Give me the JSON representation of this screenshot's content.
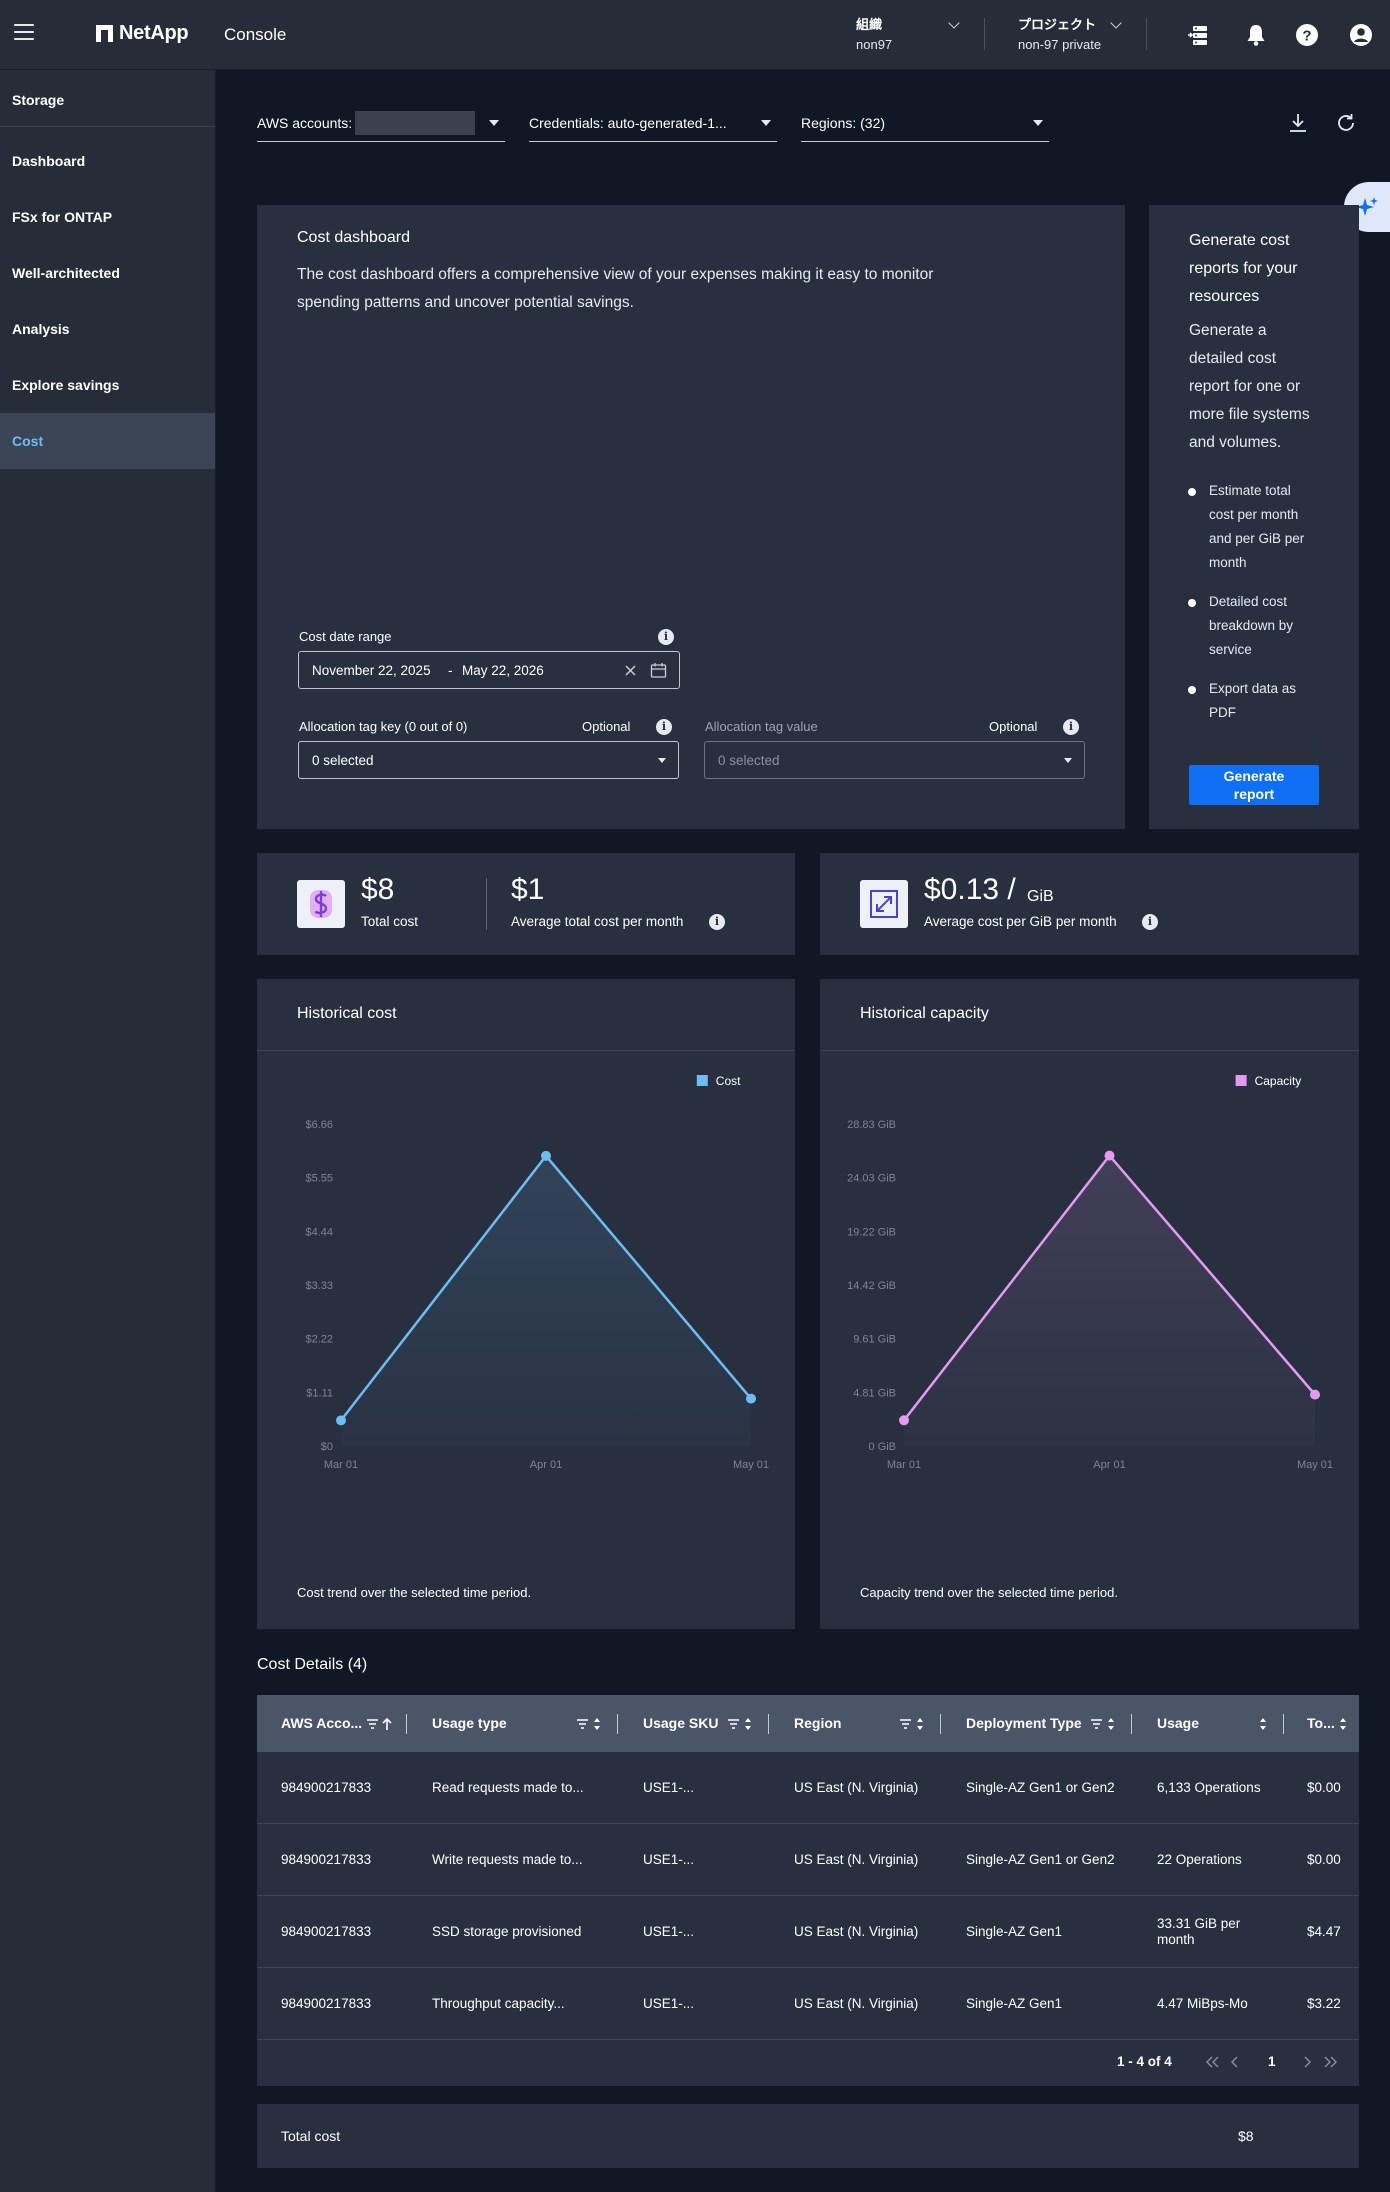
{
  "header": {
    "logo": "NetApp",
    "app": "Console",
    "org_label": "組織",
    "org_value": "non97",
    "project_label": "プロジェクト",
    "project_value": "non-97 private"
  },
  "sidebar": {
    "heading": "Storage",
    "items": [
      {
        "label": "Dashboard"
      },
      {
        "label": "FSx for ONTAP"
      },
      {
        "label": "Well-architected"
      },
      {
        "label": "Analysis"
      },
      {
        "label": "Explore savings"
      },
      {
        "label": "Cost"
      }
    ],
    "active_index": 5
  },
  "filters": {
    "aws_accounts": "AWS accounts:",
    "credentials": "Credentials: auto-generated-1...",
    "regions": "Regions: (32)"
  },
  "cost_dashboard": {
    "title": "Cost dashboard",
    "description_1": "The cost dashboard offers a comprehensive view of your expenses making it easy to monitor",
    "description_2": "spending patterns and uncover potential savings.",
    "date_range_label": "Cost date range",
    "date_start": "November 22, 2025",
    "date_sep": "-",
    "date_end": "May 22, 2026",
    "tag_key_label": "Allocation tag key (0 out of 0)",
    "tag_key_optional": "Optional",
    "tag_key_value": "0 selected",
    "tag_value_label": "Allocation tag value",
    "tag_value_optional": "Optional",
    "tag_value_value": "0 selected"
  },
  "generate_report": {
    "title_1": "Generate cost",
    "title_2": "reports for your",
    "title_3": "resources",
    "desc_1": "Generate a",
    "desc_2": "detailed cost",
    "desc_3": "report for one or",
    "desc_4": "more file systems",
    "desc_5": "and volumes.",
    "bullets": [
      {
        "l1": "Estimate total",
        "l2": "cost per month",
        "l3": "and per GiB per",
        "l4": "month"
      },
      {
        "l1": "Detailed cost",
        "l2": "breakdown by",
        "l3": "service"
      },
      {
        "l1": "Export data as",
        "l2": "PDF"
      }
    ],
    "button_1": "Generate",
    "button_2": "report"
  },
  "kpis": {
    "total_cost_value": "$8",
    "total_cost_label": "Total cost",
    "avg_month_value": "$1",
    "avg_month_label": "Average total cost per month",
    "avg_gib_value": "$0.13 /",
    "avg_gib_unit": "GiB",
    "avg_gib_label": "Average cost per GiB per month"
  },
  "chart_data": [
    {
      "type": "line",
      "title": "Historical cost",
      "x": [
        "Mar 01",
        "Apr 01",
        "May 01"
      ],
      "series": [
        {
          "name": "Cost",
          "values": [
            0.53,
            6.0,
            0.98
          ],
          "color": "#6dbcf2"
        }
      ],
      "yticks": [
        "$0",
        "$1.11",
        "$2.22",
        "$3.33",
        "$4.44",
        "$5.55",
        "$6.66"
      ],
      "ylim": [
        0,
        6.66
      ],
      "caption": "Cost trend over the selected time period.",
      "legend": "top-right"
    },
    {
      "type": "line",
      "title": "Historical capacity",
      "x": [
        "Mar 01",
        "Apr 01",
        "May 01"
      ],
      "series": [
        {
          "name": "Capacity",
          "values": [
            2.3,
            26.0,
            4.6
          ],
          "color": "#e39bf2"
        }
      ],
      "yticks": [
        "0 GiB",
        "4.81 GiB",
        "9.61 GiB",
        "14.42 GiB",
        "19.22 GiB",
        "24.03 GiB",
        "28.83 GiB"
      ],
      "ylim": [
        0,
        28.83
      ],
      "caption": "Capacity trend over the selected time period.",
      "legend": "top-right"
    }
  ],
  "cost_details": {
    "title": "Cost Details (4)",
    "columns": [
      "AWS Acco...",
      "Usage type",
      "Usage SKU",
      "Region",
      "Deployment Type",
      "Usage",
      "To..."
    ],
    "rows": [
      {
        "account": "984900217833",
        "usage_type": "Read requests made to...",
        "sku": "USE1-...",
        "region": "US East (N. Virginia)",
        "deployment": "Single-AZ Gen1 or Gen2",
        "usage_1": "6,133 Operations",
        "usage_2": "",
        "total": "$0.00"
      },
      {
        "account": "984900217833",
        "usage_type": "Write requests made to...",
        "sku": "USE1-...",
        "region": "US East (N. Virginia)",
        "deployment": "Single-AZ Gen1 or Gen2",
        "usage_1": "22 Operations",
        "usage_2": "",
        "total": "$0.00"
      },
      {
        "account": "984900217833",
        "usage_type": "SSD storage provisioned",
        "sku": "USE1-...",
        "region": "US East (N. Virginia)",
        "deployment": "Single-AZ Gen1",
        "usage_1": "33.31 GiB per",
        "usage_2": "month",
        "total": "$4.47"
      },
      {
        "account": "984900217833",
        "usage_type": "Throughput capacity...",
        "sku": "USE1-...",
        "region": "US East (N. Virginia)",
        "deployment": "Single-AZ Gen1",
        "usage_1": "4.47 MiBps-Mo",
        "usage_2": "",
        "total": "$3.22"
      }
    ],
    "pagination_range": "1 - 4 of 4",
    "page": "1",
    "total_label": "Total cost",
    "total_value": "$8"
  }
}
